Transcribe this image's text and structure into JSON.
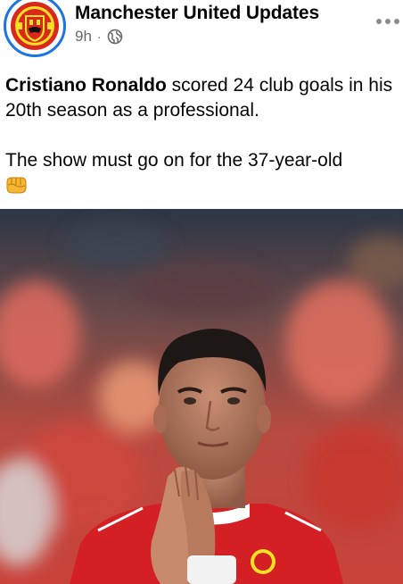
{
  "post": {
    "author": "Manchester United Updates",
    "time": "9h",
    "separator": "·",
    "audience_icon": "globe-icon",
    "more_icon": "more-options-icon",
    "avatar_icon": "manchester-united-crest",
    "text": {
      "bold_name": "Cristiano Ronaldo",
      "line1_rest": " scored 24 club goals in his 20th season as a professional.",
      "line2": "The show must go on for the 37-year-old",
      "emoji": "oncoming-fist-emoji"
    },
    "image": {
      "subject": "player-clapping-photo"
    }
  },
  "colors": {
    "author": "#050505",
    "meta": "#65676b",
    "ring": "#1b74e4",
    "club_red": "#da291c",
    "club_gold": "#fbe122"
  }
}
